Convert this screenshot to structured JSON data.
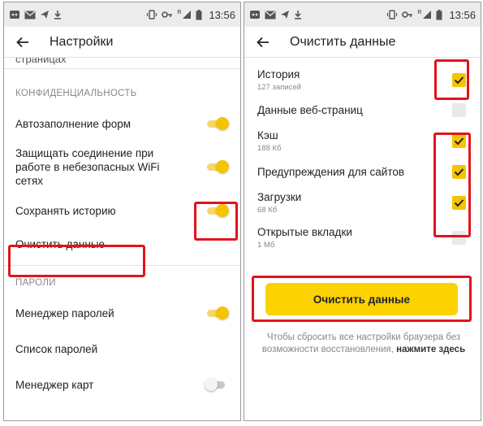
{
  "status_bar": {
    "time": "13:56",
    "signal_label": "R"
  },
  "left_screen": {
    "title": "Настройки",
    "cut_item": "страницах",
    "section_privacy": "КОНФИДЕНЦИАЛЬНОСТЬ",
    "rows": [
      {
        "label": "Автозаполнение форм",
        "toggle": true
      },
      {
        "label": "Защищать соединение при работе в небезопасных WiFi сетях",
        "toggle": true
      },
      {
        "label": "Сохранять историю",
        "toggle": true
      },
      {
        "label": "Очистить данные"
      }
    ],
    "section_passwords": "ПАРОЛИ",
    "password_rows": [
      {
        "label": "Менеджер паролей",
        "toggle": true
      },
      {
        "label": "Список паролей"
      },
      {
        "label": "Менеджер карт",
        "toggle": false
      }
    ]
  },
  "right_screen": {
    "title": "Очистить данные",
    "items": [
      {
        "label": "История",
        "sub": "127 записей",
        "checked": true
      },
      {
        "label": "Данные веб-страниц",
        "sub": "",
        "checked": false
      },
      {
        "label": "Кэш",
        "sub": "188 Кб",
        "checked": true
      },
      {
        "label": "Предупреждения для сайтов",
        "sub": "",
        "checked": true
      },
      {
        "label": "Загрузки",
        "sub": "68 Кб",
        "checked": true
      },
      {
        "label": "Открытые вкладки",
        "sub": "1 Мб",
        "checked": false
      }
    ],
    "clear_button": "Очистить данные",
    "reset_text": "Чтобы сбросить все настройки браузера без возможности восстановления,",
    "reset_link": "нажмите здесь"
  },
  "colors": {
    "accent": "#f5c400",
    "highlight": "#e1141b",
    "button": "#fcd200"
  }
}
